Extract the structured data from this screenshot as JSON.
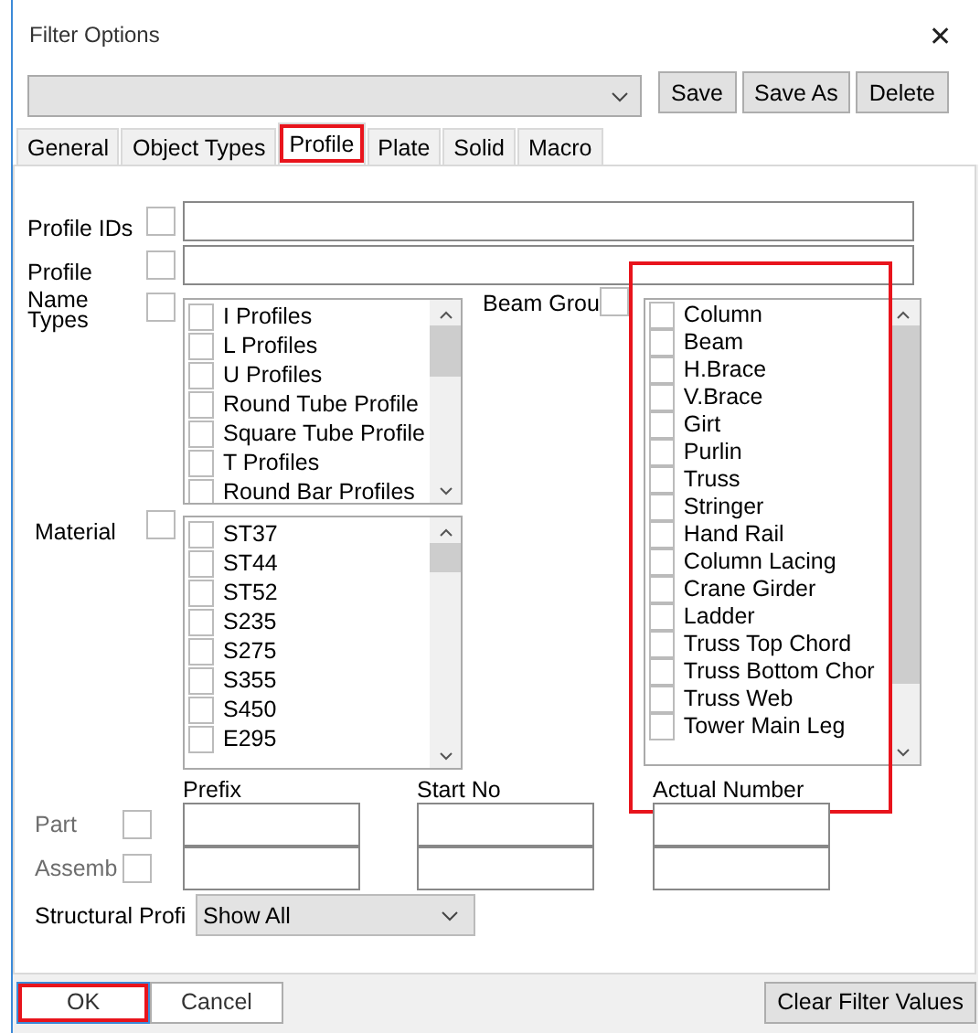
{
  "window": {
    "title": "Filter Options",
    "close": "✕"
  },
  "filter_set": {
    "buttons": [
      "Save",
      "Save As",
      "Delete"
    ]
  },
  "tabs": [
    {
      "label": "General",
      "selected": false,
      "highlighted": false
    },
    {
      "label": "Object Types",
      "selected": false,
      "highlighted": false
    },
    {
      "label": "Profile",
      "selected": true,
      "highlighted": true
    },
    {
      "label": "Plate",
      "selected": false,
      "highlighted": false
    },
    {
      "label": "Solid",
      "selected": false,
      "highlighted": false
    },
    {
      "label": "Macro",
      "selected": false,
      "highlighted": false
    }
  ],
  "profile_ids": {
    "label": "Profile IDs",
    "checked": false
  },
  "profile": {
    "label": "Profile",
    "checked": false
  },
  "name_types": {
    "label": "Name Types",
    "checked": false,
    "items": [
      {
        "label": "I Profiles",
        "checked": false
      },
      {
        "label": "L Profiles",
        "checked": false
      },
      {
        "label": "U Profiles",
        "checked": false
      },
      {
        "label": "Round Tube Profile",
        "checked": false
      },
      {
        "label": "Square Tube Profile",
        "checked": false
      },
      {
        "label": "T Profiles",
        "checked": false
      },
      {
        "label": "Round Bar Profiles",
        "checked": false
      }
    ]
  },
  "material": {
    "label": "Material",
    "checked": false,
    "items": [
      {
        "label": "ST37",
        "checked": false
      },
      {
        "label": "ST44",
        "checked": false
      },
      {
        "label": "ST52",
        "checked": false
      },
      {
        "label": "S235",
        "checked": false
      },
      {
        "label": "S275",
        "checked": false
      },
      {
        "label": "S355",
        "checked": false
      },
      {
        "label": "S450",
        "checked": false
      },
      {
        "label": "E295",
        "checked": false
      }
    ]
  },
  "beam_groups": {
    "label": "Beam Grou",
    "checked": false,
    "highlighted": true,
    "items": [
      {
        "label": "Column",
        "checked": false
      },
      {
        "label": "Beam",
        "checked": false
      },
      {
        "label": "H.Brace",
        "checked": false
      },
      {
        "label": "V.Brace",
        "checked": false
      },
      {
        "label": "Girt",
        "checked": false
      },
      {
        "label": "Purlin",
        "checked": false
      },
      {
        "label": "Truss",
        "checked": false
      },
      {
        "label": "Stringer",
        "checked": false
      },
      {
        "label": "Hand Rail",
        "checked": false
      },
      {
        "label": "Column Lacing",
        "checked": false
      },
      {
        "label": "Crane Girder",
        "checked": false
      },
      {
        "label": "Ladder",
        "checked": false
      },
      {
        "label": "Truss Top Chord",
        "checked": false
      },
      {
        "label": "Truss Bottom Chor",
        "checked": false
      },
      {
        "label": "Truss Web",
        "checked": false
      },
      {
        "label": "Tower Main Leg",
        "checked": false
      }
    ]
  },
  "numbering": {
    "columns": [
      "Prefix",
      "Start No",
      "Actual Number"
    ],
    "rows": [
      {
        "label": "Part",
        "checked": false,
        "disabled": true
      },
      {
        "label": "Assemb",
        "checked": false,
        "disabled": true
      }
    ]
  },
  "structural_profile": {
    "label": "Structural Profi",
    "value": "Show All"
  },
  "footer": {
    "buttons": [
      {
        "label": "OK",
        "highlighted": true
      },
      {
        "label": "Cancel",
        "highlighted": false
      }
    ],
    "clear": "Clear Filter Values"
  }
}
